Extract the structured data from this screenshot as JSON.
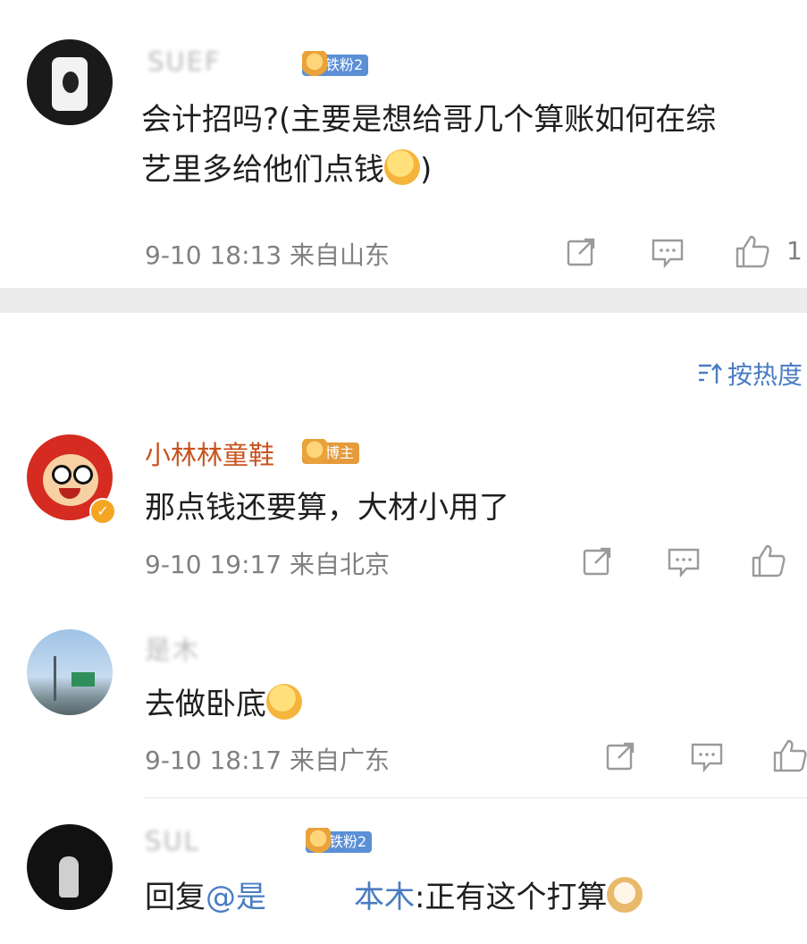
{
  "sort_label": "按热度",
  "comments": [
    {
      "name": "SUEF",
      "badge": "铁粉2",
      "text": "会计招吗?(主要是想给哥几个算账如何在综",
      "text_line2": "艺里多给他们点钱",
      "text_line2_tail": ")",
      "time": "9-10 18:13",
      "location": "来自山东",
      "likes": "1"
    },
    {
      "name": "小林林童鞋",
      "badge": "博主",
      "text": "那点钱还要算，大材小用了",
      "time": "9-10 19:17",
      "location": "来自北京"
    },
    {
      "name": "是木",
      "badge": "",
      "text": "去做卧底",
      "time": "9-10 18:17",
      "location": "来自广东"
    },
    {
      "name": "SUL",
      "badge": "铁粉2",
      "reply_prefix": "回复",
      "mention_start": "@是",
      "mention_end": "本木",
      "text": ":正有这个打算"
    }
  ],
  "icons": [
    "share-icon",
    "comment-icon",
    "like-icon",
    "sort-icon",
    "verified-icon"
  ],
  "colors": {
    "name": "#c8531f",
    "mention": "#4a7cc2",
    "badge_iron": "#5b8fd6",
    "badge_boss": "#e59a3b"
  }
}
